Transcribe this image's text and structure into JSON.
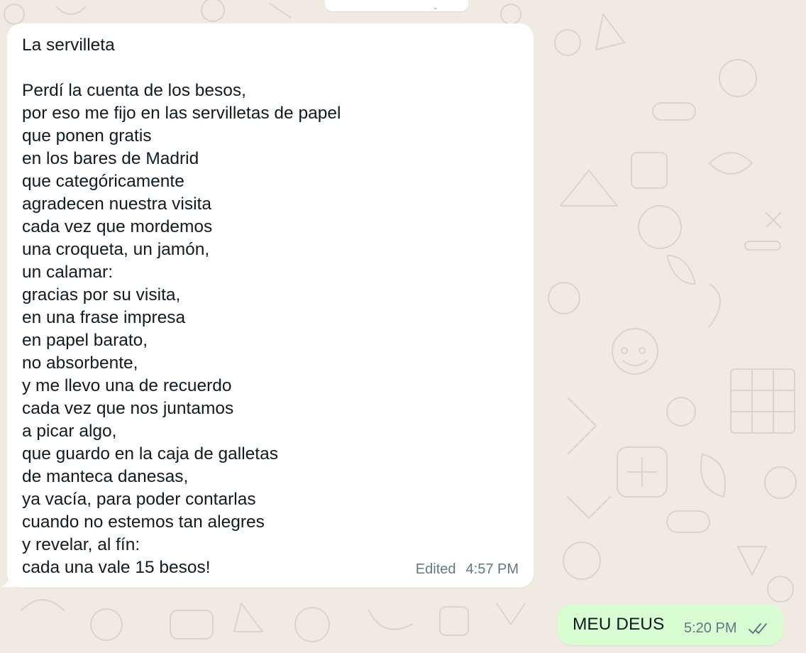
{
  "colors": {
    "wallpaper": "#efeae2",
    "incoming_bubble": "#ffffff",
    "outgoing_bubble": "#d9fdd3",
    "text": "#111b21",
    "meta_text": "#667781",
    "read_receipt": "#667781"
  },
  "incoming_message": {
    "title": "La servilleta",
    "lines": [
      "Perdí la cuenta de los besos,",
      "por eso me fijo en las servilletas de papel",
      "que ponen gratis",
      "en los bares de Madrid",
      "que categóricamente",
      "agradecen nuestra visita",
      "cada vez que mordemos",
      "una croqueta, un jamón,",
      "un calamar:",
      "gracias por su visita,",
      "en una frase impresa",
      "en papel barato,",
      "no absorbente,",
      "y me llevo una de recuerdo",
      "cada vez que nos juntamos",
      "a picar algo,",
      "que guardo en la caja de galletas",
      "de manteca danesas,",
      "ya vacía, para poder contarlas",
      "cuando no estemos tan alegres",
      "y revelar, al fín:",
      "cada una vale 15 besos!"
    ],
    "edited_label": "Edited",
    "time": "4:57 PM"
  },
  "outgoing_message": {
    "text": "MEU DEUS",
    "time": "5:20 PM",
    "status_icon": "double-check-read-icon"
  }
}
